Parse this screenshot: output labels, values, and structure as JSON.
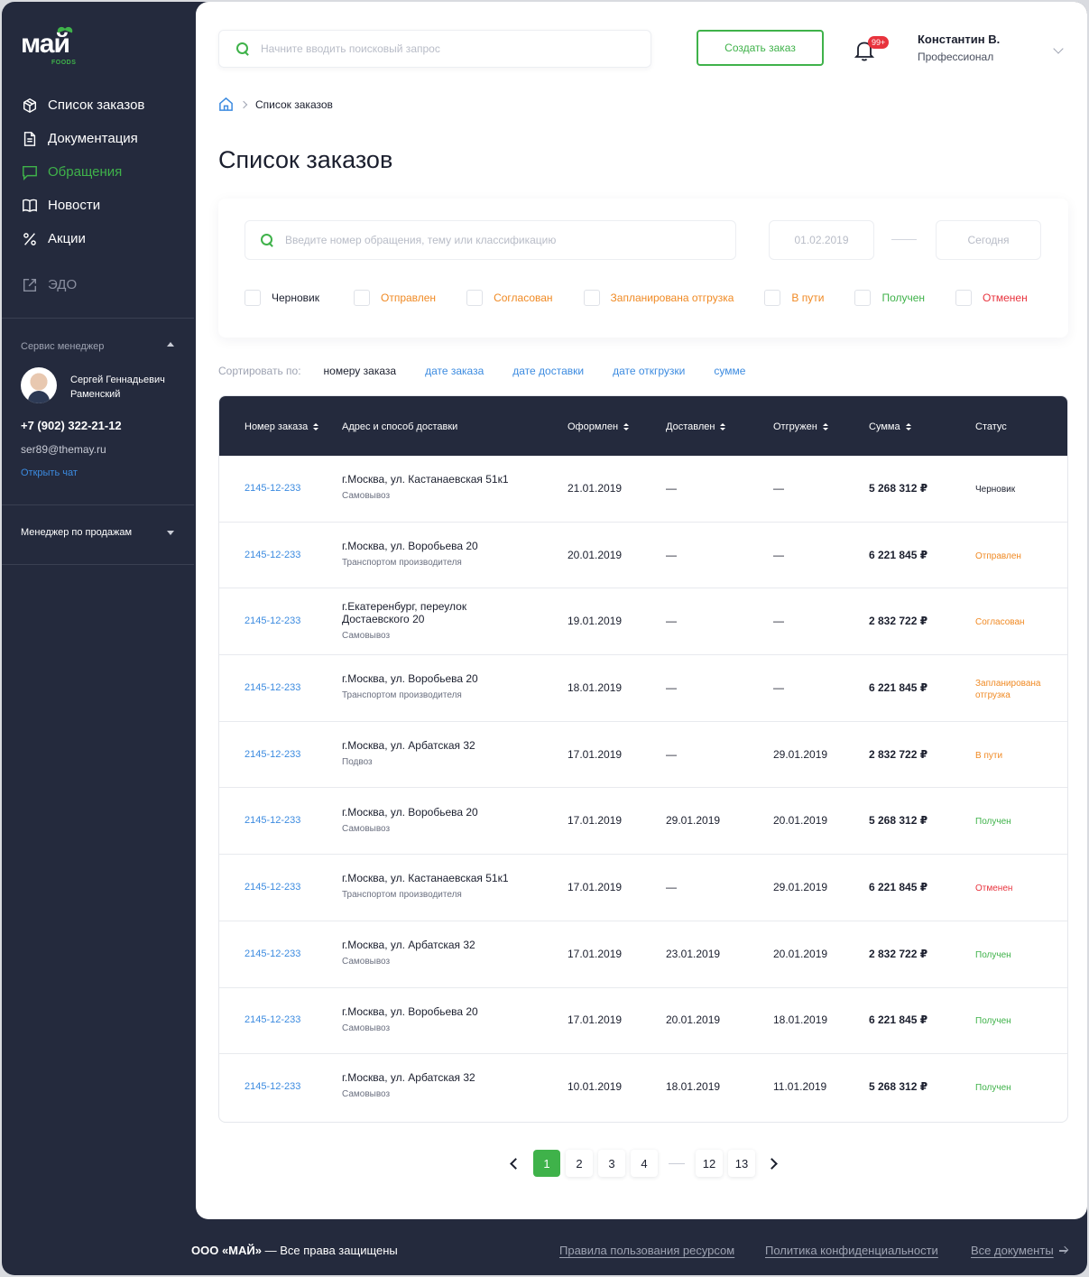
{
  "brand": {
    "logo_text": "май",
    "logo_sub": "FOODS",
    "accent": "#3fb24a",
    "dark": "#242a3d",
    "link": "#3c8be0"
  },
  "sidebar": {
    "items": [
      {
        "label": "Список заказов",
        "icon": "box-icon"
      },
      {
        "label": "Документация",
        "icon": "document-icon"
      },
      {
        "label": "Обращения",
        "icon": "chat-icon",
        "active": true
      },
      {
        "label": "Новости",
        "icon": "book-icon"
      },
      {
        "label": "Акции",
        "icon": "percent-icon"
      },
      {
        "label": "ЭДО",
        "icon": "external-link-icon"
      }
    ],
    "service_manager": {
      "title": "Сервис менеджер",
      "name": "Сергей Геннадьевич Раменский",
      "phone": "+7 (902) 322-21-12",
      "email": "ser89@themay.ru",
      "chat_link": "Открыть чат"
    },
    "sales_manager_title": "Менеджер по продажам"
  },
  "header": {
    "search_placeholder": "Начните вводить поисковый запрос",
    "create_button": "Создать заказ",
    "notifications_badge": "99+",
    "user_name": "Константин В.",
    "user_role": "Профессионал"
  },
  "breadcrumb": {
    "current": "Список заказов"
  },
  "page_title": "Список заказов",
  "filters": {
    "search_placeholder": "Введите номер обращения, тему или классификацию",
    "date_from_placeholder": "01.02.2019",
    "date_to_placeholder": "Сегодня",
    "statuses": [
      {
        "label": "Черновик",
        "color": "#1b1f2e"
      },
      {
        "label": "Отправлен",
        "color": "#f08a24"
      },
      {
        "label": "Согласован",
        "color": "#f08a24"
      },
      {
        "label": "Запланирована отгрузка",
        "color": "#f08a24"
      },
      {
        "label": "В пути",
        "color": "#f08a24"
      },
      {
        "label": "Получен",
        "color": "#3fb24a"
      },
      {
        "label": "Отменен",
        "color": "#e8333d"
      }
    ]
  },
  "sort": {
    "label": "Сортировать по:",
    "options": [
      "номеру заказа",
      "дате заказа",
      "дате доставки",
      "дате откгрузки",
      "сумме"
    ]
  },
  "table": {
    "columns": [
      "Номер заказа",
      "Адрес и способ доставки",
      "Оформлен",
      "Доставлен",
      "Отгружен",
      "Сумма",
      "Статус"
    ],
    "rows": [
      {
        "num": "2145-12-233",
        "addr": "г.Москва, ул. Кастанаевская 51к1",
        "method": "Самовывоз",
        "created": "21.01.2019",
        "delivered": "—",
        "shipped": "—",
        "sum": "5 268 312 ₽",
        "status": "Черновик",
        "status_color": "#1b1f2e"
      },
      {
        "num": "2145-12-233",
        "addr": "г.Москва, ул. Воробьева 20",
        "method": "Транспортом производителя",
        "created": "20.01.2019",
        "delivered": "—",
        "shipped": "—",
        "sum": "6 221 845 ₽",
        "status": "Отправлен",
        "status_color": "#f08a24"
      },
      {
        "num": "2145-12-233",
        "addr": "г.Екатеренбург, переулок Достаевского 20",
        "method": "Самовывоз",
        "created": "19.01.2019",
        "delivered": "—",
        "shipped": "—",
        "sum": "2 832 722 ₽",
        "status": "Согласован",
        "status_color": "#f08a24"
      },
      {
        "num": "2145-12-233",
        "addr": "г.Москва, ул. Воробьева 20",
        "method": "Транспортом производителя",
        "created": "18.01.2019",
        "delivered": "—",
        "shipped": "—",
        "sum": "6 221 845 ₽",
        "status": "Запланирована отгрузка",
        "status_color": "#f08a24"
      },
      {
        "num": "2145-12-233",
        "addr": "г.Москва, ул. Арбатская 32",
        "method": "Подвоз",
        "created": "17.01.2019",
        "delivered": "—",
        "shipped": "29.01.2019",
        "sum": "2 832 722 ₽",
        "status": "В пути",
        "status_color": "#f08a24"
      },
      {
        "num": "2145-12-233",
        "addr": "г.Москва, ул. Воробьева 20",
        "method": "Самовывоз",
        "created": "17.01.2019",
        "delivered": "29.01.2019",
        "shipped": "20.01.2019",
        "sum": "5 268 312 ₽",
        "status": "Получен",
        "status_color": "#3fb24a"
      },
      {
        "num": "2145-12-233",
        "addr": "г.Москва, ул. Кастанаевская 51к1",
        "method": "Транспортом производителя",
        "created": "17.01.2019",
        "delivered": "—",
        "shipped": "29.01.2019",
        "sum": "6 221 845 ₽",
        "status": "Отменен",
        "status_color": "#e8333d"
      },
      {
        "num": "2145-12-233",
        "addr": "г.Москва, ул. Арбатская 32",
        "method": "Самовывоз",
        "created": "17.01.2019",
        "delivered": "23.01.2019",
        "shipped": "20.01.2019",
        "sum": "2 832 722 ₽",
        "status": "Получен",
        "status_color": "#3fb24a"
      },
      {
        "num": "2145-12-233",
        "addr": "г.Москва, ул. Воробьева 20",
        "method": "Самовывоз",
        "created": "17.01.2019",
        "delivered": "20.01.2019",
        "shipped": "18.01.2019",
        "sum": "6 221 845 ₽",
        "status": "Получен",
        "status_color": "#3fb24a"
      },
      {
        "num": "2145-12-233",
        "addr": "г.Москва, ул. Арбатская 32",
        "method": "Самовывоз",
        "created": "10.01.2019",
        "delivered": "18.01.2019",
        "shipped": "11.01.2019",
        "sum": "5 268 312 ₽",
        "status": "Получен",
        "status_color": "#3fb24a"
      }
    ]
  },
  "pagination": {
    "pages": [
      "1",
      "2",
      "3",
      "4"
    ],
    "last_pages": [
      "12",
      "13"
    ],
    "current": "1"
  },
  "footer": {
    "copyright_company": "ООО «МАЙ»",
    "copyright_rest": " — Все права защищены",
    "links": [
      "Правила пользования ресурсом",
      "Политика конфиденциальности",
      "Все документы"
    ]
  }
}
